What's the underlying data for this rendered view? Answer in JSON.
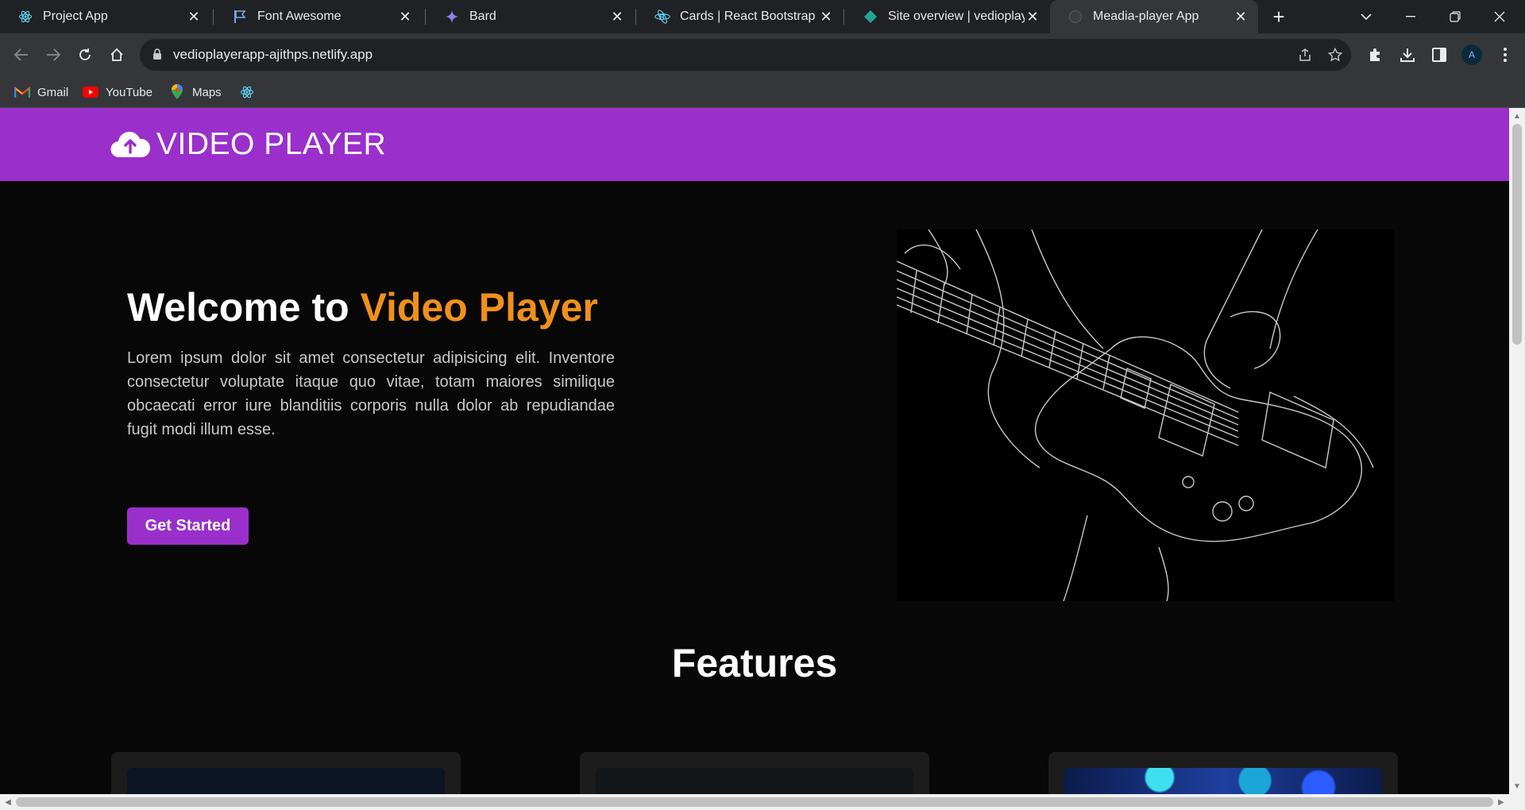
{
  "browser": {
    "tabs": [
      {
        "title": "Project App",
        "icon": "react-icon"
      },
      {
        "title": "Font Awesome",
        "icon": "flag-icon"
      },
      {
        "title": "Bard",
        "icon": "bard-sparkle-icon"
      },
      {
        "title": "Cards | React Bootstrap",
        "icon": "react-bootstrap-icon"
      },
      {
        "title": "Site overview | vedioplayer",
        "icon": "netlify-icon"
      },
      {
        "title": "Meadia-player App",
        "icon": "globe-icon"
      }
    ],
    "active_tab": 5,
    "url": "vedioplayerapp-ajithps.netlify.app",
    "profile_initial": "A",
    "bookmarks": [
      {
        "label": "Gmail",
        "icon": "gmail-icon"
      },
      {
        "label": "YouTube",
        "icon": "youtube-icon"
      },
      {
        "label": "Maps",
        "icon": "maps-icon"
      },
      {
        "label": "",
        "icon": "react-icon"
      }
    ]
  },
  "navbar": {
    "brand": "VIDEO PLAYER",
    "brand_icon": "cloud-upload-icon"
  },
  "hero": {
    "title_prefix": "Welcome to ",
    "title_accent": "Video Player",
    "body": "Lorem ipsum dolor sit amet consectetur adipisicing elit. Inventore consectetur voluptate itaque quo vitae, totam maiores similique obcaecati error iure blanditiis corporis nulla dolor ab repudiandae fugit modi illum esse.",
    "cta_label": "Get Started",
    "image": "guitar-line-drawing"
  },
  "features": {
    "heading": "Features"
  },
  "colors": {
    "brand_purple": "#9b2fcc",
    "accent_orange": "#f0901c",
    "page_bg": "#080808"
  }
}
